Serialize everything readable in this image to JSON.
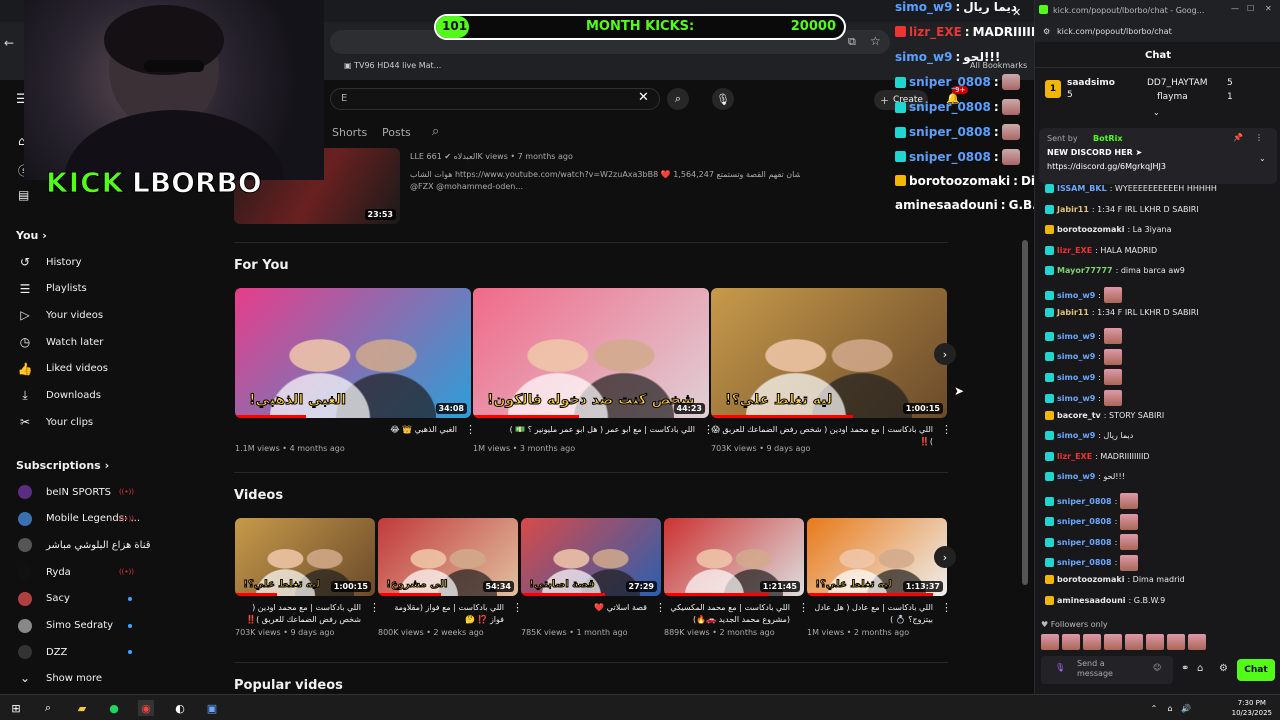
{
  "browser": {
    "tabs": [
      {
        "label": "TV96 HD44 live Mat..."
      }
    ],
    "bookmarks_label": "All Bookmarks",
    "create_label": "Create",
    "notif_count": "9+"
  },
  "yt": {
    "search_value": "E",
    "channel_tabs": [
      "Shorts",
      "Posts"
    ],
    "top_video": {
      "duration": "23:53",
      "channel": "LLE العبدلاه",
      "meta": "661K views • 7 months ago",
      "desc1": "هوات الشاب https://www.youtube.com/watch?v=W2zuAxa3bB8 ❤️ مشاركة الجزء الأول عشان تفهم القصة وتستمتع 1,564,247",
      "desc2": "@FZX @mohammed-oden..."
    },
    "sidebar": {
      "you_label": "You",
      "items": [
        {
          "label": "History",
          "icon": "history-icon",
          "glyph": "↺"
        },
        {
          "label": "Playlists",
          "icon": "playlists-icon",
          "glyph": "☰"
        },
        {
          "label": "Your videos",
          "icon": "your-videos-icon",
          "glyph": "▷"
        },
        {
          "label": "Watch later",
          "icon": "watch-later-icon",
          "glyph": "◷"
        },
        {
          "label": "Liked videos",
          "icon": "like-icon",
          "glyph": "👍"
        },
        {
          "label": "Downloads",
          "icon": "download-icon",
          "glyph": "⤓"
        },
        {
          "label": "Your clips",
          "icon": "scissors-icon",
          "glyph": "✂"
        }
      ],
      "subscriptions_label": "Subscriptions",
      "subscriptions": [
        {
          "name": "beIN SPORTS",
          "color": "#5a2d82",
          "status": "live"
        },
        {
          "name": "Mobile Legends: ...",
          "color": "#3a6fb0",
          "status": "live"
        },
        {
          "name": "قناة هزاع البلوشي مباشر",
          "color": "#555555",
          "status": "none"
        },
        {
          "name": "Ryda",
          "color": "#111111",
          "status": "live"
        },
        {
          "name": "Sacy",
          "color": "#b04040",
          "status": "dot"
        },
        {
          "name": "Simo Sedraty",
          "color": "#888888",
          "status": "dot"
        },
        {
          "name": "DZZ",
          "color": "#333333",
          "status": "dot"
        }
      ],
      "show_more_label": "Show more"
    },
    "for_you": {
      "title": "For You",
      "videos": [
        {
          "title": "الغبي الذهبي 👑 😂",
          "meta": "1.1M views • 4 months ago",
          "duration": "34:08",
          "colors": [
            "#e63e8a",
            "#2a9fd8"
          ],
          "caption": "الغبي الذهبي!"
        },
        {
          "title": "اللي بادكاست | مع ابو عمر ( هل ابو عمر مليونير ؟ 💵 )",
          "meta": "1M views • 3 months ago",
          "duration": "44:23",
          "colors": [
            "#f06a8a",
            "#e0d0d5"
          ],
          "caption": "شخص كنت ضد دخوله فالكون!"
        },
        {
          "title": "اللي بادكاست | مع محمد اودين ( شخص رفض الضماعك للعربق 😱 )‼️",
          "meta": "703K views • 9 days ago",
          "duration": "1:00:15",
          "colors": [
            "#c79a4a",
            "#6a4a2a"
          ],
          "caption": "ليه تغلط علي؟!"
        }
      ]
    },
    "videos": {
      "title": "Videos",
      "items": [
        {
          "title": "اللي بادكاست | مع محمد اودين ( شخص رفض الضماعك للعربق )‼️",
          "meta": "703K views • 9 days ago",
          "duration": "1:00:15",
          "colors": [
            "#c79a4a",
            "#6a4a2a"
          ],
          "caption": "ليه تغلط علي؟!"
        },
        {
          "title": "اللي بادكاست | مع فواز (مقلاومة فواز ⁉️ 🤔",
          "meta": "800K views • 2 weeks ago",
          "duration": "54:34",
          "colors": [
            "#c23a3a",
            "#e0c0a0"
          ],
          "caption": "الى مشروع!"
        },
        {
          "title": "قصة اسلاتي ❤️",
          "meta": "785K views • 1 month ago",
          "duration": "27:29",
          "colors": [
            "#d84a4a",
            "#2a5fb0"
          ],
          "caption": "قصة اصابتي!"
        },
        {
          "title": "اللي بادكاست | مع محمد المكسيكي (مشروع محمد الجديد 🚗🔥)",
          "meta": "889K views • 2 months ago",
          "duration": "1:21:45",
          "colors": [
            "#c33",
            "#ddd"
          ],
          "caption": ""
        },
        {
          "title": "اللي بادكاست | مع عادل ( هل عادل بيتزوج؟ 💍 )",
          "meta": "1M views • 2 months ago",
          "duration": "1:13:37",
          "colors": [
            "#e87a1a",
            "#eee"
          ],
          "caption": "ليه تغلط علي؟!"
        }
      ]
    },
    "popular_title": "Popular videos"
  },
  "overlay": {
    "kick_label": "KICK",
    "streamer": "LBORBO",
    "goal": {
      "current": "101",
      "label": "MONTH KICKS:",
      "target": "20000",
      "progress": 0.0505
    },
    "chat": [
      {
        "user": "simo_w9",
        "text": "ديما ريال",
        "badge": "none"
      },
      {
        "user": "lizr_EXE",
        "text": "MADRIIIIIIIID",
        "badge": "red",
        "user_color": "#e33"
      },
      {
        "user": "simo_w9",
        "text": "لحو!!!",
        "badge": "none"
      },
      {
        "user": "sniper_0808",
        "text": "",
        "badge": "blue",
        "emote": true
      },
      {
        "user": "sniper_0808",
        "text": "",
        "badge": "blue",
        "emote": true
      },
      {
        "user": "sniper_0808",
        "text": "",
        "badge": "blue",
        "emote": true
      },
      {
        "user": "sniper_0808",
        "text": "",
        "badge": "blue",
        "emote": true
      },
      {
        "user": "borotoozomaki",
        "text": "Dima madrid",
        "badge": "gold",
        "user_color": "#ffffff"
      },
      {
        "user": "aminesaadouni",
        "text": "G.B.W.9",
        "badge": "none",
        "user_color": "#ffffff"
      }
    ]
  },
  "kick": {
    "window_title": "kick.com/popout/lborbo/chat - Goog...",
    "url": "kick.com/popout/lborbo/chat",
    "chat_label": "Chat",
    "leaderboard": [
      {
        "rank": "1",
        "name": "saadsimo",
        "count": "5"
      },
      {
        "rank": "",
        "name": "DD7_HAYTAM",
        "count": "5"
      },
      {
        "rank": "",
        "name": "flayma",
        "count": "1"
      }
    ],
    "pinned": {
      "sent_by": "Sent by",
      "bot": "BotRix",
      "title": "NEW DISCORD HER ➤",
      "link": "https://discord.gg/6MgrkqJHJ3"
    },
    "messages": [
      {
        "user": "ISSAM_BKL",
        "text": ": WYEEEEEEEEEEH HHHHH",
        "color": "#6aa8ff",
        "emote": false
      },
      {
        "user": "Jabir11",
        "text": ": 1:34 F IRL LKHR D SABIRI",
        "color": "#e0c27a",
        "emote": false
      },
      {
        "user": "borotoozomaki",
        "text": ": La 3iyana",
        "color": "#e8e8e8",
        "emote": false
      },
      {
        "user": "lizr_EXE",
        "text": ": HALA MADRID",
        "color": "#e33",
        "emote": false
      },
      {
        "user": "Mayor77777",
        "text": ": dima barca aw9",
        "color": "#7ad36a",
        "emote": false
      },
      {
        "user": "simo_w9",
        "text": ":",
        "color": "#6aa8ff",
        "emote": true
      },
      {
        "user": "Jabir11",
        "text": ": 1:34 F IRL LKHR D SABIRI",
        "color": "#e0c27a",
        "emote": false
      },
      {
        "user": "simo_w9",
        "text": ":",
        "color": "#6aa8ff",
        "emote": true
      },
      {
        "user": "simo_w9",
        "text": ":",
        "color": "#6aa8ff",
        "emote": true
      },
      {
        "user": "simo_w9",
        "text": ":",
        "color": "#6aa8ff",
        "emote": true
      },
      {
        "user": "simo_w9",
        "text": ":",
        "color": "#6aa8ff",
        "emote": true
      },
      {
        "user": "bacore_tv",
        "text": ": STORY SABIRI",
        "color": "#e8e8e8",
        "emote": false
      },
      {
        "user": "simo_w9",
        "text": ": ديما ريال",
        "color": "#6aa8ff",
        "emote": false
      },
      {
        "user": "lizr_EXE",
        "text": ": MADRIIIIIIIID",
        "color": "#e33",
        "emote": false
      },
      {
        "user": "simo_w9",
        "text": ": لحو!!!",
        "color": "#6aa8ff",
        "emote": false
      },
      {
        "user": "sniper_0808",
        "text": ":",
        "color": "#6aa8ff",
        "emote": true
      },
      {
        "user": "sniper_0808",
        "text": ":",
        "color": "#6aa8ff",
        "emote": true
      },
      {
        "user": "sniper_0808",
        "text": ":",
        "color": "#6aa8ff",
        "emote": true
      },
      {
        "user": "sniper_0808",
        "text": ":",
        "color": "#6aa8ff",
        "emote": true
      },
      {
        "user": "borotoozomaki",
        "text": ": Dima madrid",
        "color": "#e8e8e8",
        "emote": false
      },
      {
        "user": "aminesaadouni",
        "text": ": G.B.W.9",
        "color": "#e8e8e8",
        "emote": false
      }
    ],
    "followers_only": "Followers only",
    "send_placeholder": "Send a message",
    "chat_button": "Chat",
    "accent": "#53fc18"
  },
  "taskbar": {
    "time": "7:30 PM",
    "date": "10/23/2025"
  }
}
